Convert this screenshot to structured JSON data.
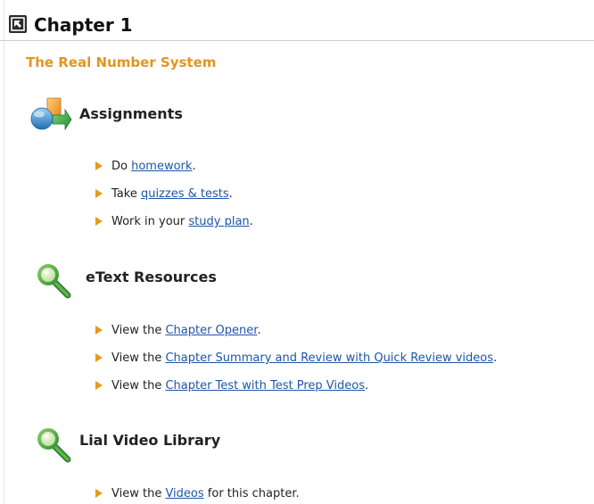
{
  "colors": {
    "accent": "#E0961F",
    "link": "#1F55A8",
    "bullet": "#E89A1C",
    "text": "#222222"
  },
  "header": {
    "toggle_icon": "collapse-arrow-icon",
    "title": "Chapter 1"
  },
  "section": {
    "title": "The Real Number System"
  },
  "groups": [
    {
      "icon": "assignments-icon",
      "heading": "Assignments",
      "items": [
        {
          "prefix": "Do ",
          "link": "homework",
          "suffix": "."
        },
        {
          "prefix": "Take ",
          "link": "quizzes & tests",
          "suffix": "."
        },
        {
          "prefix": "Work in your ",
          "link": "study plan",
          "suffix": "."
        }
      ]
    },
    {
      "icon": "magnifier-icon",
      "heading": "eText Resources",
      "items": [
        {
          "prefix": "View the ",
          "link": "Chapter Opener",
          "suffix": "."
        },
        {
          "prefix": "View the ",
          "link": "Chapter Summary and Review with Quick Review videos",
          "suffix": "."
        },
        {
          "prefix": "View the ",
          "link": "Chapter Test with Test Prep Videos",
          "suffix": "."
        }
      ]
    },
    {
      "icon": "magnifier-icon",
      "heading": "Lial Video Library",
      "items": [
        {
          "prefix": "View the ",
          "link": "Videos",
          "suffix": " for this chapter."
        }
      ]
    }
  ]
}
